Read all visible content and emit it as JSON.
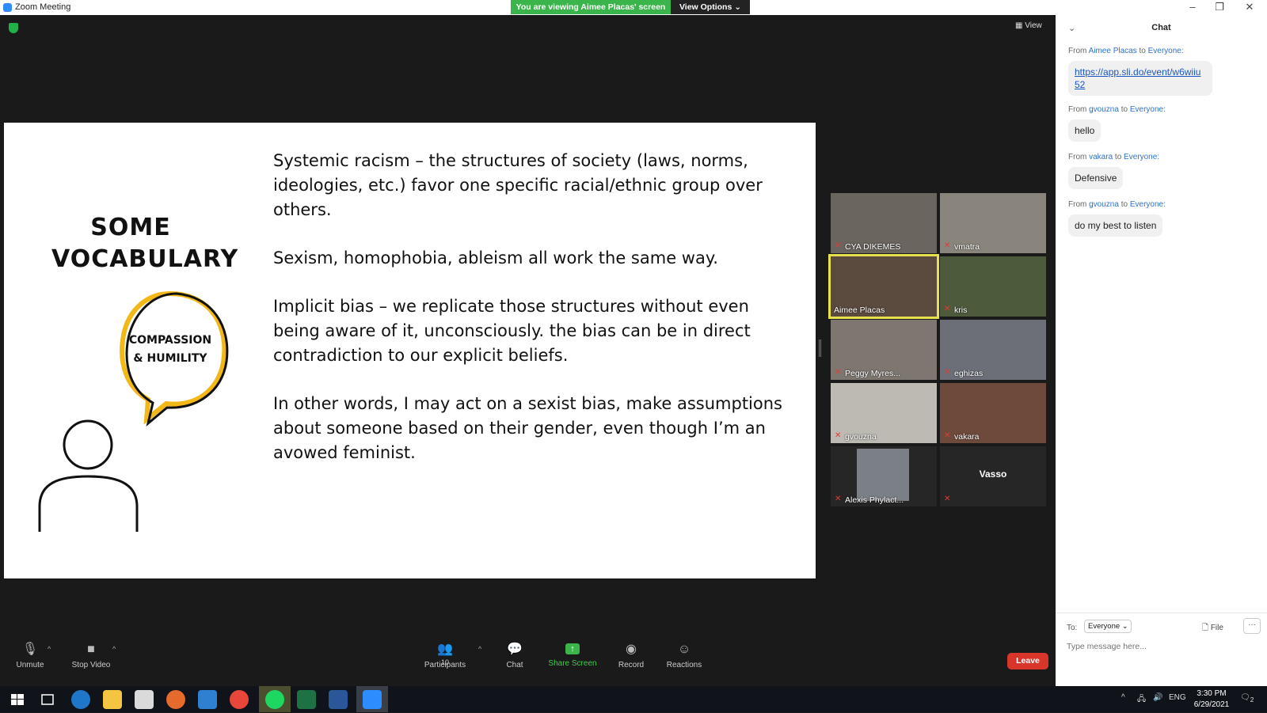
{
  "window": {
    "title": "Zoom Meeting"
  },
  "banner": {
    "viewing": "You are viewing Aimee Placas' screen",
    "view_options": "View Options ⌄"
  },
  "top": {
    "view_label": "View"
  },
  "slide": {
    "heading_line1": "SOME",
    "heading_line2": "VOCABULARY",
    "bubble_line1": "COMPASSION",
    "bubble_line2": "& HUMILITY",
    "paragraphs": [
      "Systemic racism – the structures of society (laws, norms, ideologies, etc.) favor one specific racial/ethnic group over others.",
      "Sexism, homophobia, ableism all work the same way.",
      "Implicit bias – we replicate those structures without even being aware of it, unconsciously. the bias can be in direct contradiction to our explicit beliefs.",
      "In other words, I may act on a sexist bias, make assumptions about someone based on their gender, even though I’m an avowed feminist."
    ]
  },
  "gallery": {
    "participants": [
      {
        "name": "CYA DIKEMES"
      },
      {
        "name": "vmatra"
      },
      {
        "name": "Aimee Placas"
      },
      {
        "name": "kris"
      },
      {
        "name": "Peggy Myres..."
      },
      {
        "name": "eghizas"
      },
      {
        "name": "gvouzna"
      },
      {
        "name": "vakara"
      },
      {
        "name": "Alexis Phylact..."
      },
      {
        "name": "Vasso"
      }
    ]
  },
  "toolbar": {
    "unmute": "Unmute",
    "stop_video": "Stop Video",
    "participants": "Participants",
    "participants_count": "10",
    "chat": "Chat",
    "share_screen": "Share Screen",
    "record": "Record",
    "reactions": "Reactions",
    "leave": "Leave"
  },
  "chat": {
    "header": "Chat",
    "messages": [
      {
        "from_prefix": "From",
        "sender": "Aimee Placas",
        "to_word": "to",
        "recipient": "Everyone:",
        "text": "https://app.sli.do/event/w6wiiu52"
      },
      {
        "from_prefix": "From",
        "sender": "gvouzna",
        "to_word": "to",
        "recipient": "Everyone:",
        "text": "hello"
      },
      {
        "from_prefix": "From",
        "sender": "vakara",
        "to_word": "to",
        "recipient": "Everyone:",
        "text": "Defensive"
      },
      {
        "from_prefix": "From",
        "sender": "gvouzna",
        "to_word": "to",
        "recipient": "Everyone:",
        "text": "do my best to listen"
      }
    ],
    "to_label": "To:",
    "to_value": "Everyone ⌄",
    "file_label": "File",
    "more_label": "···",
    "placeholder": "Type message here..."
  },
  "taskbar": {
    "language": "ENG",
    "time": "3:30 PM",
    "date": "6/29/2021",
    "notifications": "2"
  }
}
